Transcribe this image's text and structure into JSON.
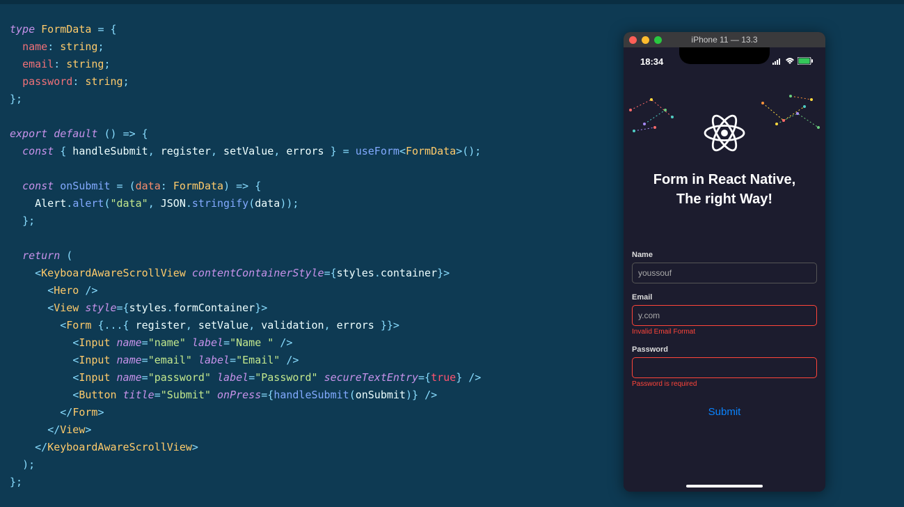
{
  "code": {
    "lines": [
      [
        [
          "kw",
          "type"
        ],
        [
          "def",
          " "
        ],
        [
          "type",
          "FormData"
        ],
        [
          "def",
          " "
        ],
        [
          "punc",
          "="
        ],
        [
          "def",
          " "
        ],
        [
          "punc",
          "{"
        ]
      ],
      [
        [
          "def",
          "  "
        ],
        [
          "prop",
          "name"
        ],
        [
          "punc",
          ":"
        ],
        [
          "def",
          " "
        ],
        [
          "type",
          "string"
        ],
        [
          "punc",
          ";"
        ]
      ],
      [
        [
          "def",
          "  "
        ],
        [
          "prop",
          "email"
        ],
        [
          "punc",
          ":"
        ],
        [
          "def",
          " "
        ],
        [
          "type",
          "string"
        ],
        [
          "punc",
          ";"
        ]
      ],
      [
        [
          "def",
          "  "
        ],
        [
          "prop",
          "password"
        ],
        [
          "punc",
          ":"
        ],
        [
          "def",
          " "
        ],
        [
          "type",
          "string"
        ],
        [
          "punc",
          ";"
        ]
      ],
      [
        [
          "punc",
          "};"
        ]
      ],
      [],
      [
        [
          "kw",
          "export"
        ],
        [
          "def",
          " "
        ],
        [
          "kw",
          "default"
        ],
        [
          "def",
          " "
        ],
        [
          "punc",
          "()"
        ],
        [
          "def",
          " "
        ],
        [
          "punc",
          "=>"
        ],
        [
          "def",
          " "
        ],
        [
          "punc",
          "{"
        ]
      ],
      [
        [
          "def",
          "  "
        ],
        [
          "kw",
          "const"
        ],
        [
          "def",
          " "
        ],
        [
          "punc",
          "{"
        ],
        [
          "def",
          " handleSubmit"
        ],
        [
          "punc",
          ","
        ],
        [
          "def",
          " register"
        ],
        [
          "punc",
          ","
        ],
        [
          "def",
          " setValue"
        ],
        [
          "punc",
          ","
        ],
        [
          "def",
          " errors "
        ],
        [
          "punc",
          "}"
        ],
        [
          "def",
          " "
        ],
        [
          "punc",
          "="
        ],
        [
          "def",
          " "
        ],
        [
          "fn",
          "useForm"
        ],
        [
          "punc",
          "<"
        ],
        [
          "type",
          "FormData"
        ],
        [
          "punc",
          ">();"
        ]
      ],
      [],
      [
        [
          "def",
          "  "
        ],
        [
          "kw",
          "const"
        ],
        [
          "def",
          " "
        ],
        [
          "fn",
          "onSubmit"
        ],
        [
          "def",
          " "
        ],
        [
          "punc",
          "="
        ],
        [
          "def",
          " "
        ],
        [
          "punc",
          "("
        ],
        [
          "paren",
          "data"
        ],
        [
          "punc",
          ":"
        ],
        [
          "def",
          " "
        ],
        [
          "type",
          "FormData"
        ],
        [
          "punc",
          ")"
        ],
        [
          "def",
          " "
        ],
        [
          "punc",
          "=>"
        ],
        [
          "def",
          " "
        ],
        [
          "punc",
          "{"
        ]
      ],
      [
        [
          "def",
          "    Alert"
        ],
        [
          "punc",
          "."
        ],
        [
          "fn",
          "alert"
        ],
        [
          "punc",
          "("
        ],
        [
          "str",
          "\"data\""
        ],
        [
          "punc",
          ","
        ],
        [
          "def",
          " JSON"
        ],
        [
          "punc",
          "."
        ],
        [
          "fn",
          "stringify"
        ],
        [
          "punc",
          "("
        ],
        [
          "def",
          "data"
        ],
        [
          "punc",
          "));"
        ]
      ],
      [
        [
          "def",
          "  "
        ],
        [
          "punc",
          "};"
        ]
      ],
      [],
      [
        [
          "def",
          "  "
        ],
        [
          "kw",
          "return"
        ],
        [
          "def",
          " "
        ],
        [
          "punc",
          "("
        ]
      ],
      [
        [
          "def",
          "    "
        ],
        [
          "jsx-punc",
          "<"
        ],
        [
          "tag",
          "KeyboardAwareScrollView"
        ],
        [
          "def",
          " "
        ],
        [
          "attr",
          "contentContainerStyle"
        ],
        [
          "jsx-punc",
          "={"
        ],
        [
          "def",
          "styles"
        ],
        [
          "punc",
          "."
        ],
        [
          "def",
          "container"
        ],
        [
          "jsx-punc",
          "}>"
        ]
      ],
      [
        [
          "def",
          "      "
        ],
        [
          "jsx-punc",
          "<"
        ],
        [
          "tag",
          "Hero"
        ],
        [
          "def",
          " "
        ],
        [
          "jsx-punc",
          "/>"
        ]
      ],
      [
        [
          "def",
          "      "
        ],
        [
          "jsx-punc",
          "<"
        ],
        [
          "tag",
          "View"
        ],
        [
          "def",
          " "
        ],
        [
          "attr",
          "style"
        ],
        [
          "jsx-punc",
          "={"
        ],
        [
          "def",
          "styles"
        ],
        [
          "punc",
          "."
        ],
        [
          "def",
          "formContainer"
        ],
        [
          "jsx-punc",
          "}>"
        ]
      ],
      [
        [
          "def",
          "        "
        ],
        [
          "jsx-punc",
          "<"
        ],
        [
          "tag",
          "Form"
        ],
        [
          "def",
          " "
        ],
        [
          "jsx-punc",
          "{...{"
        ],
        [
          "def",
          " register"
        ],
        [
          "punc",
          ","
        ],
        [
          "def",
          " setValue"
        ],
        [
          "punc",
          ","
        ],
        [
          "def",
          " validation"
        ],
        [
          "punc",
          ","
        ],
        [
          "def",
          " errors "
        ],
        [
          "jsx-punc",
          "}}>"
        ]
      ],
      [
        [
          "def",
          "          "
        ],
        [
          "jsx-punc",
          "<"
        ],
        [
          "tag",
          "Input"
        ],
        [
          "def",
          " "
        ],
        [
          "attr",
          "name"
        ],
        [
          "jsx-punc",
          "="
        ],
        [
          "str",
          "\"name\""
        ],
        [
          "def",
          " "
        ],
        [
          "attr",
          "label"
        ],
        [
          "jsx-punc",
          "="
        ],
        [
          "str",
          "\"Name \""
        ],
        [
          "def",
          " "
        ],
        [
          "jsx-punc",
          "/>"
        ]
      ],
      [
        [
          "def",
          "          "
        ],
        [
          "jsx-punc",
          "<"
        ],
        [
          "tag",
          "Input"
        ],
        [
          "def",
          " "
        ],
        [
          "attr",
          "name"
        ],
        [
          "jsx-punc",
          "="
        ],
        [
          "str",
          "\"email\""
        ],
        [
          "def",
          " "
        ],
        [
          "attr",
          "label"
        ],
        [
          "jsx-punc",
          "="
        ],
        [
          "str",
          "\"Email\""
        ],
        [
          "def",
          " "
        ],
        [
          "jsx-punc",
          "/>"
        ]
      ],
      [
        [
          "def",
          "          "
        ],
        [
          "jsx-punc",
          "<"
        ],
        [
          "tag",
          "Input"
        ],
        [
          "def",
          " "
        ],
        [
          "attr",
          "name"
        ],
        [
          "jsx-punc",
          "="
        ],
        [
          "str",
          "\"password\""
        ],
        [
          "def",
          " "
        ],
        [
          "attr",
          "label"
        ],
        [
          "jsx-punc",
          "="
        ],
        [
          "str",
          "\"Password\""
        ],
        [
          "def",
          " "
        ],
        [
          "attr",
          "secureTextEntry"
        ],
        [
          "jsx-punc",
          "={"
        ],
        [
          "bool",
          "true"
        ],
        [
          "jsx-punc",
          "}"
        ],
        [
          "def",
          " "
        ],
        [
          "jsx-punc",
          "/>"
        ]
      ],
      [
        [
          "def",
          "          "
        ],
        [
          "jsx-punc",
          "<"
        ],
        [
          "tag",
          "Button"
        ],
        [
          "def",
          " "
        ],
        [
          "attr",
          "title"
        ],
        [
          "jsx-punc",
          "="
        ],
        [
          "str",
          "\"Submit\""
        ],
        [
          "def",
          " "
        ],
        [
          "attr",
          "onPress"
        ],
        [
          "jsx-punc",
          "={"
        ],
        [
          "fn",
          "handleSubmit"
        ],
        [
          "punc",
          "("
        ],
        [
          "def",
          "onSubmit"
        ],
        [
          "punc",
          ")"
        ],
        [
          "jsx-punc",
          "}"
        ],
        [
          "def",
          " "
        ],
        [
          "jsx-punc",
          "/>"
        ]
      ],
      [
        [
          "def",
          "        "
        ],
        [
          "jsx-punc",
          "</"
        ],
        [
          "tag",
          "Form"
        ],
        [
          "jsx-punc",
          ">"
        ]
      ],
      [
        [
          "def",
          "      "
        ],
        [
          "jsx-punc",
          "</"
        ],
        [
          "tag",
          "View"
        ],
        [
          "jsx-punc",
          ">"
        ]
      ],
      [
        [
          "def",
          "    "
        ],
        [
          "jsx-punc",
          "</"
        ],
        [
          "tag",
          "KeyboardAwareScrollView"
        ],
        [
          "jsx-punc",
          ">"
        ]
      ],
      [
        [
          "def",
          "  "
        ],
        [
          "punc",
          ");"
        ]
      ],
      [
        [
          "punc",
          "};"
        ]
      ]
    ]
  },
  "phone": {
    "window_title": "iPhone 11 — 13.3",
    "status_time": "18:34",
    "hero_line1": "Form in React Native,",
    "hero_line2": "The right Way!",
    "fields": {
      "name": {
        "label": "Name",
        "value": "youssouf",
        "error": ""
      },
      "email": {
        "label": "Email",
        "value": "y.com",
        "error": "Invalid Email Format"
      },
      "password": {
        "label": "Password",
        "value": "",
        "error": "Password is required"
      }
    },
    "submit_label": "Submit"
  }
}
